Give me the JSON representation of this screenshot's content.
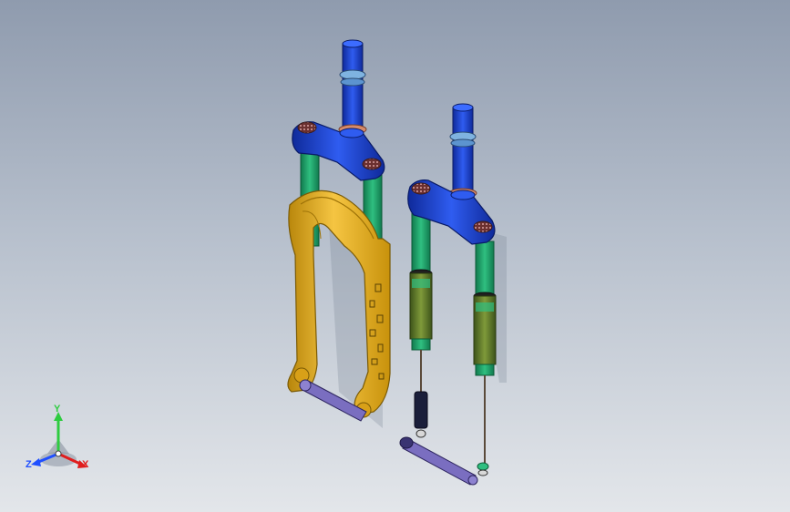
{
  "viewport": {
    "name": "cad-graphics-area",
    "background_top": "#8f9bae",
    "background_bottom": "#e3e6ea"
  },
  "model": {
    "assembly": "suspension-fork-pair",
    "parts": [
      {
        "name": "steerer-tube",
        "color": "#1f3fb8"
      },
      {
        "name": "crown",
        "color": "#2244d6"
      },
      {
        "name": "stanchions",
        "color": "#1f8f5e"
      },
      {
        "name": "lower-legs",
        "color": "#e0a810"
      },
      {
        "name": "damper-body",
        "color": "#4f6b22"
      },
      {
        "name": "through-axle",
        "color": "#6f5fb0"
      },
      {
        "name": "top-caps",
        "color": "#7b3a3a"
      }
    ]
  },
  "triad": {
    "x_label": "X",
    "y_label": "Y",
    "z_label": "Z",
    "x_color": "#e01d1d",
    "y_color": "#2ecc40",
    "z_color": "#1f4fff"
  }
}
